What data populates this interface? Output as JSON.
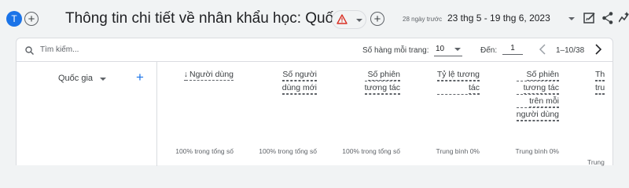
{
  "header": {
    "avatar_letter": "T",
    "title": "Thông tin chi tiết về nhân khẩu học: Quốc gia",
    "days_ago": "28 ngày trước",
    "date_range": "23 thg 5 - 19 thg 6, 2023",
    "icons": [
      "add-comparison-icon",
      "warning-icon",
      "add-comparison-icon",
      "edit-report-icon",
      "share-icon",
      "insights-icon"
    ]
  },
  "toolbar": {
    "search_placeholder": "Tìm kiếm...",
    "rows_label": "Số hàng mỗi trang:",
    "rows_value": "10",
    "goto_label": "Đến:",
    "goto_value": "1",
    "page_info": "1–10/38"
  },
  "table": {
    "dimension": "Quốc gia",
    "columns": [
      {
        "lines": [
          "Người dùng"
        ],
        "total": "100% trong tổng số",
        "sorted": true
      },
      {
        "lines": [
          "Số người",
          "dùng mới"
        ],
        "total": "100% trong tổng số"
      },
      {
        "lines": [
          "Số phiên",
          "tương tác"
        ],
        "total": "100% trong tổng số"
      },
      {
        "lines": [
          "Tỷ lệ tương",
          "tác"
        ],
        "total": "Trung bình 0%"
      },
      {
        "lines": [
          "Số phiên",
          "tương tác",
          "trên mỗi",
          "người dùng"
        ],
        "total": "Trung bình 0%"
      },
      {
        "lines": [
          "Th",
          "tru"
        ],
        "total": "Trung"
      }
    ]
  },
  "colors": {
    "accent": "#1a73e8",
    "warning": "#d93025",
    "background": "#f1f3f4"
  }
}
